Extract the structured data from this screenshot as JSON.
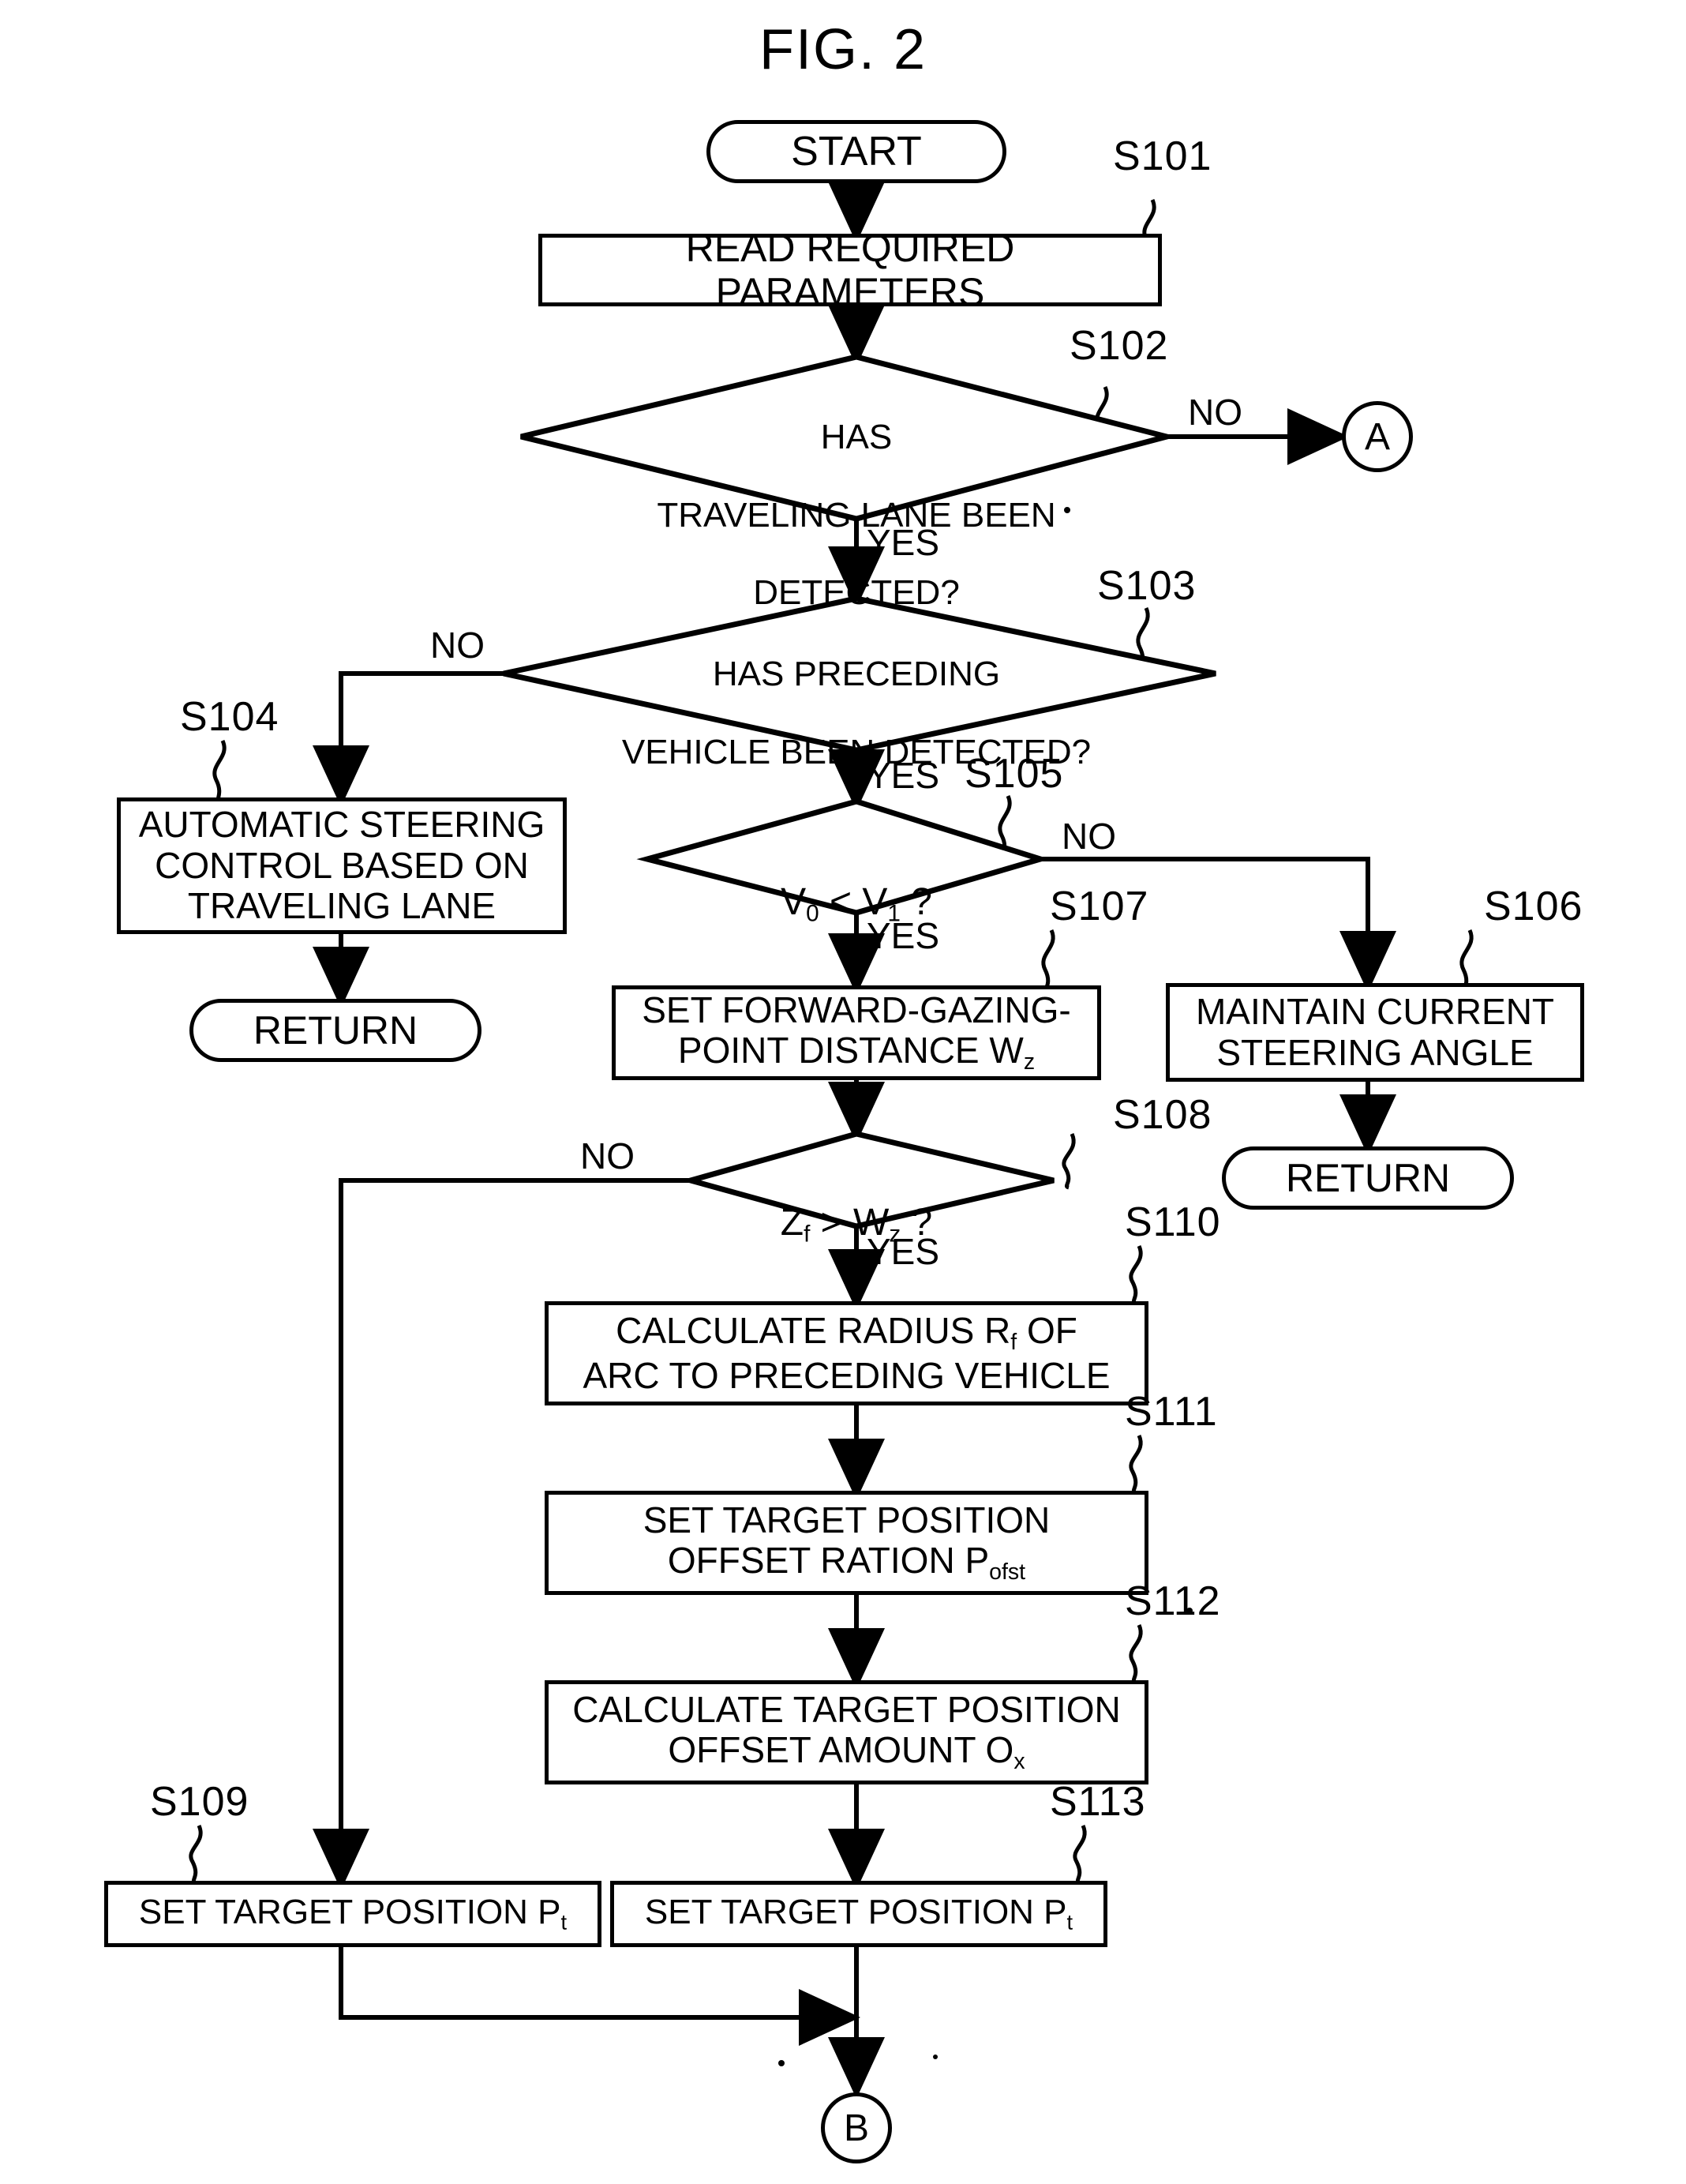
{
  "figure": {
    "title": "FIG. 2"
  },
  "nodes": {
    "start": {
      "label": "START"
    },
    "s101": {
      "step": "S101",
      "label": "READ REQUIRED PARAMETERS"
    },
    "s102": {
      "step": "S102",
      "line1": "HAS",
      "line2": "TRAVELING LANE BEEN",
      "line3": "DETECTED?"
    },
    "s103": {
      "step": "S103",
      "line1": "HAS PRECEDING",
      "line2": "VEHICLE BEEN DETECTED?"
    },
    "s104": {
      "step": "S104",
      "line1": "AUTOMATIC STEERING",
      "line2": "CONTROL BASED ON",
      "line3": "TRAVELING LANE"
    },
    "return1": {
      "label": "RETURN"
    },
    "s105": {
      "step": "S105",
      "v0": "V",
      "v0sub": "0",
      "op": " < ",
      "v1": "V",
      "v1sub": "1",
      "tail": " ?"
    },
    "s106": {
      "step": "S106",
      "line1": "MAINTAIN CURRENT",
      "line2": "STEERING ANGLE"
    },
    "return2": {
      "label": "RETURN"
    },
    "s107": {
      "step": "S107",
      "line1": "SET FORWARD-GAZING-",
      "line2a": "POINT DISTANCE W",
      "line2sub": "z"
    },
    "s108": {
      "step": "S108",
      "zf": "Z",
      "zfsub": "f",
      "op": " > ",
      "wz": "W",
      "wzsub": "z",
      "tail": " ?"
    },
    "s110": {
      "step": "S110",
      "line1a": "CALCULATE RADIUS R",
      "line1sub": "f",
      "line1b": " OF",
      "line2": "ARC TO PRECEDING VEHICLE"
    },
    "s111": {
      "step": "S111",
      "line1": "SET TARGET POSITION",
      "line2a": "OFFSET RATION P",
      "line2sub": "ofst"
    },
    "s112": {
      "step": "S112",
      "line1": "CALCULATE TARGET POSITION",
      "line2a": "OFFSET AMOUNT O",
      "line2sub": "x"
    },
    "s109": {
      "step": "S109",
      "labela": "SET TARGET POSITION P",
      "labelsub": "t"
    },
    "s113": {
      "step": "S113",
      "labela": "SET TARGET POSITION P",
      "labelsub": "t"
    },
    "conn_a": {
      "label": "A"
    },
    "conn_b": {
      "label": "B"
    }
  },
  "branch_labels": {
    "s102_no": "NO",
    "s102_yes": "YES",
    "s103_no": "NO",
    "s103_yes": "YES",
    "s105_no": "NO",
    "s105_yes": "YES",
    "s108_no": "NO",
    "s108_yes": "YES"
  },
  "colors": {
    "ink": "#000000",
    "paper": "#ffffff"
  }
}
